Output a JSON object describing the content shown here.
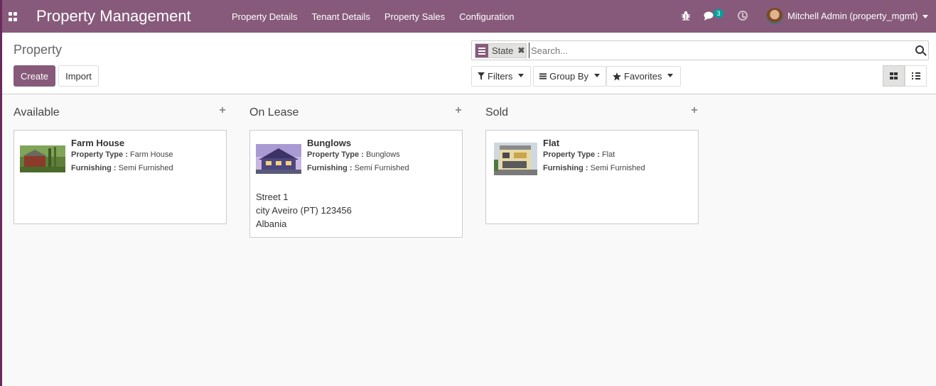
{
  "navbar": {
    "brand": "Property Management",
    "menu": [
      "Property Details",
      "Tenant Details",
      "Property Sales",
      "Configuration"
    ],
    "chat_badge": "3",
    "user_name": "Mitchell Admin (property_mgmt)",
    "color": "#875a7b"
  },
  "control_panel": {
    "breadcrumb": "Property",
    "create_label": "Create",
    "import_label": "Import",
    "search": {
      "facet_label": "State",
      "placeholder": "Search..."
    },
    "filters_label": "Filters",
    "group_by_label": "Group By",
    "favorites_label": "Favorites"
  },
  "kanban": {
    "columns": [
      {
        "title": "Available",
        "cards": [
          {
            "title": "Farm House",
            "property_type_label": "Property Type :",
            "property_type": "Farm House",
            "furnishing_label": "Furnishing :",
            "furnishing": "Semi Furnished",
            "image": "farm-house-photo"
          }
        ]
      },
      {
        "title": "On Lease",
        "cards": [
          {
            "title": "Bunglows",
            "property_type_label": "Property Type :",
            "property_type": "Bunglows",
            "furnishing_label": "Furnishing :",
            "furnishing": "Semi Furnished",
            "image": "bunglow-photo",
            "address": [
              "Street 1",
              "city Aveiro (PT) 123456",
              "Albania"
            ]
          }
        ]
      },
      {
        "title": "Sold",
        "cards": [
          {
            "title": "Flat",
            "property_type_label": "Property Type :",
            "property_type": "Flat",
            "furnishing_label": "Furnishing :",
            "furnishing": "Semi Furnished",
            "image": "flat-photo"
          }
        ]
      }
    ]
  }
}
